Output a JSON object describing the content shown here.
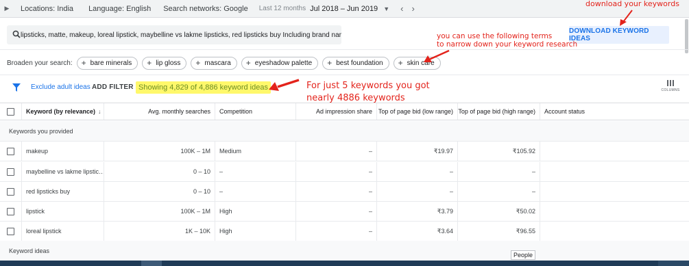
{
  "topbar": {
    "locations": "Locations: India",
    "language": "Language: English",
    "networks": "Search networks: Google",
    "period_label": "Last 12 months",
    "date_range": "Jul 2018 – Jun 2019"
  },
  "search": {
    "query": "lipsticks, matte, makeup, loreal lipstick, maybelline vs lakme lipsticks, red lipsticks buy  Including brand names"
  },
  "download_button": "DOWNLOAD KEYWORD IDEAS",
  "broaden": {
    "label": "Broaden your search:",
    "chips": [
      "bare minerals",
      "lip gloss",
      "mascara",
      "eyeshadow palette",
      "best foundation",
      "skin care"
    ]
  },
  "filter": {
    "exclude": "Exclude adult ideas",
    "add_filter": "ADD FILTER",
    "showing": "Showing 4,829 of 4,886 keyword ideas"
  },
  "columns_label": "COLUMNS",
  "annotations": {
    "download": "download your keywords",
    "narrow_line1": "you can use the following terms",
    "narrow_line2": "to narrow down your keyword research",
    "count_line1": "For just 5 keywords you got",
    "count_line2": "nearly 4886 keywords"
  },
  "table": {
    "headers": {
      "keyword": "Keyword (by relevance)",
      "sort": "↓",
      "searches": "Avg. monthly searches",
      "competition": "Competition",
      "impression": "Ad impression share",
      "bid_low": "Top of page bid (low range)",
      "bid_high": "Top of page bid (high range)",
      "account": "Account status"
    },
    "group_provided": "Keywords you provided",
    "group_ideas": "Keyword ideas",
    "rows": [
      {
        "keyword": "makeup",
        "searches": "100K – 1M",
        "competition": "Medium",
        "impression": "–",
        "bid_low": "₹19.97",
        "bid_high": "₹105.92"
      },
      {
        "keyword": "maybelline vs lakme lipstic…",
        "searches": "0 – 10",
        "competition": "–",
        "impression": "–",
        "bid_low": "–",
        "bid_high": "–"
      },
      {
        "keyword": "red lipsticks buy",
        "searches": "0 – 10",
        "competition": "–",
        "impression": "–",
        "bid_low": "–",
        "bid_high": "–"
      },
      {
        "keyword": "lipstick",
        "searches": "100K – 1M",
        "competition": "High",
        "impression": "–",
        "bid_low": "₹3.79",
        "bid_high": "₹50.02"
      },
      {
        "keyword": "loreal lipstick",
        "searches": "1K – 10K",
        "competition": "High",
        "impression": "–",
        "bid_low": "₹3.64",
        "bid_high": "₹96.55"
      }
    ]
  },
  "tooltip": "People",
  "colors": {
    "accent": "#1a73e8",
    "annotation": "#e3231b",
    "highlight": "#fff86b"
  }
}
